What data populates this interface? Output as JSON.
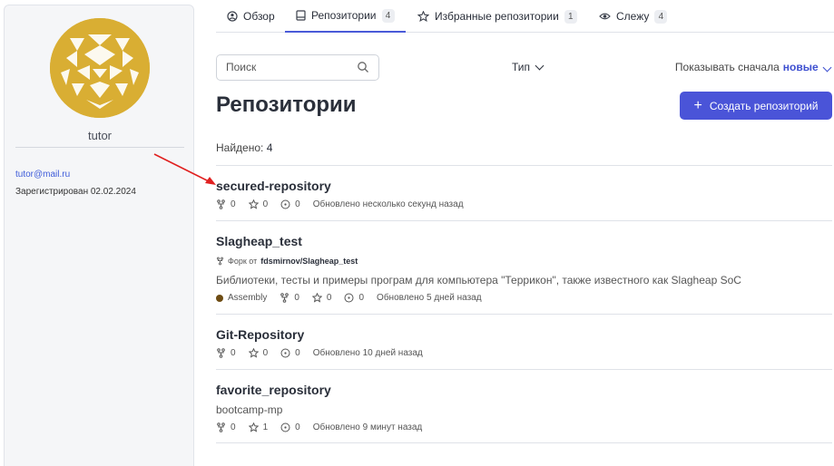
{
  "profile": {
    "username": "tutor",
    "email": "tutor@mail.ru",
    "registered": "Зарегистрирован 02.02.2024"
  },
  "tabs": [
    {
      "label": "Обзор",
      "icon": "overview-icon"
    },
    {
      "label": "Репозитории",
      "badge": "4",
      "icon": "repo-icon",
      "active": true
    },
    {
      "label": "Избранные репозитории",
      "badge": "1",
      "icon": "star-icon"
    },
    {
      "label": "Слежу",
      "badge": "4",
      "icon": "eye-icon"
    }
  ],
  "search": {
    "placeholder": "Поиск"
  },
  "filters": {
    "type_label": "Тип",
    "sort_prefix": "Показывать сначала",
    "sort_value": "новые"
  },
  "page": {
    "title": "Репозитории",
    "create_label": "Создать репозиторий",
    "found_label": "Найдено:",
    "found_count": "4"
  },
  "repos": [
    {
      "name": "secured-repository",
      "forks": "0",
      "stars": "0",
      "issues": "0",
      "updated": "Обновлено несколько секунд назад"
    },
    {
      "name": "Slagheap_test",
      "fork_prefix": "Форк от",
      "fork_source": "fdsmirnov/Slagheap_test",
      "description": "Библиотеки, тесты и примеры програм для компьютера \"Террикон\", также известного как Slagheap SoC",
      "language": "Assembly",
      "forks": "0",
      "stars": "0",
      "issues": "0",
      "updated": "Обновлено 5 дней назад"
    },
    {
      "name": "Git-Repository",
      "forks": "0",
      "stars": "0",
      "issues": "0",
      "updated": "Обновлено 10 дней назад"
    },
    {
      "name": "favorite_repository",
      "description": "bootcamp-mp",
      "forks": "0",
      "stars": "1",
      "issues": "0",
      "updated": "Обновлено 9 минут назад"
    }
  ],
  "colors": {
    "accent": "#4a54d8",
    "link": "#3d5bd9",
    "avatar": "#d9ae33",
    "language_assembly": "#6e4c13",
    "annotation_arrow": "#e02020"
  }
}
